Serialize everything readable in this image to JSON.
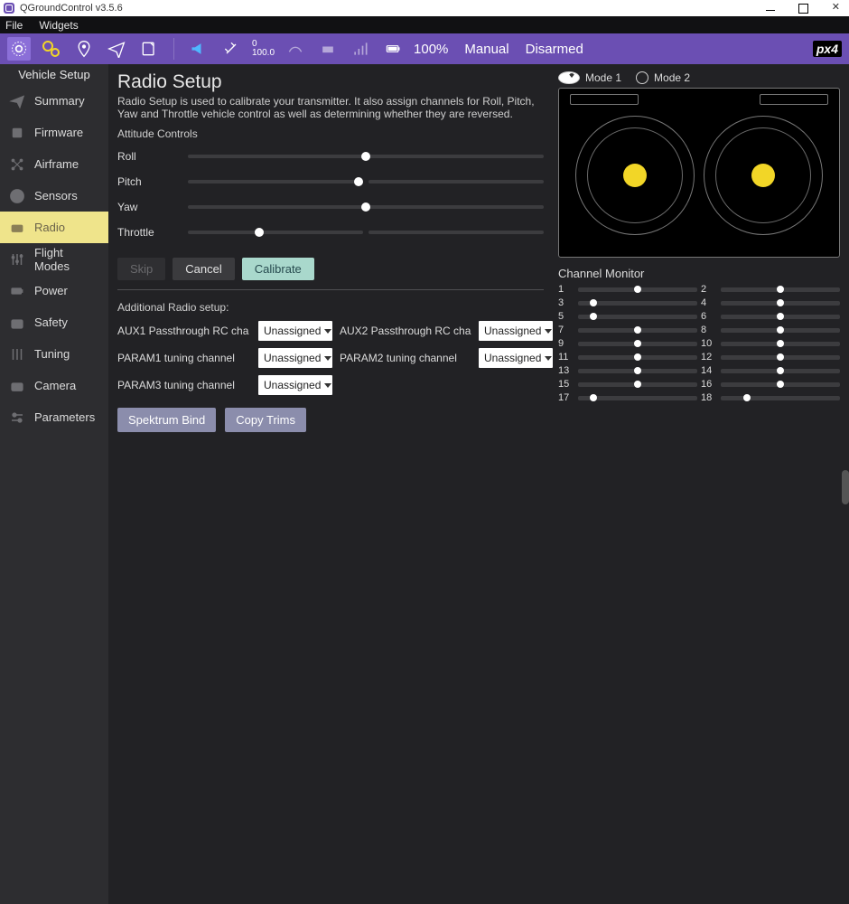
{
  "window": {
    "title": "QGroundControl v3.5.6"
  },
  "menu": {
    "file": "File",
    "widgets": "Widgets"
  },
  "toolbar": {
    "gps_top": "0",
    "gps_bottom": "100.0",
    "battery": "100%",
    "mode": "Manual",
    "arm": "Disarmed",
    "logo": "px4"
  },
  "sidebar": {
    "heading": "Vehicle Setup",
    "items": [
      {
        "label": "Summary"
      },
      {
        "label": "Firmware"
      },
      {
        "label": "Airframe"
      },
      {
        "label": "Sensors"
      },
      {
        "label": "Radio"
      },
      {
        "label": "Flight Modes"
      },
      {
        "label": "Power"
      },
      {
        "label": "Safety"
      },
      {
        "label": "Tuning"
      },
      {
        "label": "Camera"
      },
      {
        "label": "Parameters"
      }
    ]
  },
  "page": {
    "title": "Radio Setup",
    "desc": "Radio Setup is used to calibrate your transmitter. It also assign channels for Roll, Pitch, Yaw and Throttle vehicle control as well as determining whether they are reversed.",
    "attitude_heading": "Attitude Controls",
    "controls": [
      {
        "label": "Roll",
        "pos": 50
      },
      {
        "label": "Pitch",
        "pos": 48
      },
      {
        "label": "Yaw",
        "pos": 50
      },
      {
        "label": "Throttle",
        "pos": 20
      }
    ],
    "btn_skip": "Skip",
    "btn_cancel": "Cancel",
    "btn_calibrate": "Calibrate",
    "additional_heading": "Additional Radio setup:",
    "fields": {
      "aux1": "AUX1 Passthrough RC cha",
      "aux2": "AUX2 Passthrough RC cha",
      "param1": "PARAM1 tuning channel",
      "param2": "PARAM2 tuning channel",
      "param3": "PARAM3 tuning channel"
    },
    "unassigned": "Unassigned",
    "btn_spektrum": "Spektrum Bind",
    "btn_copytrims": "Copy Trims"
  },
  "modes": {
    "m1": "Mode 1",
    "m2": "Mode 2"
  },
  "channel_monitor": {
    "heading": "Channel Monitor",
    "channels": [
      {
        "n": 1,
        "p": 50
      },
      {
        "n": 2,
        "p": 50
      },
      {
        "n": 3,
        "p": 13
      },
      {
        "n": 4,
        "p": 50
      },
      {
        "n": 5,
        "p": 13
      },
      {
        "n": 6,
        "p": 50
      },
      {
        "n": 7,
        "p": 50
      },
      {
        "n": 8,
        "p": 50
      },
      {
        "n": 9,
        "p": 50
      },
      {
        "n": 10,
        "p": 50
      },
      {
        "n": 11,
        "p": 50
      },
      {
        "n": 12,
        "p": 50
      },
      {
        "n": 13,
        "p": 50
      },
      {
        "n": 14,
        "p": 50
      },
      {
        "n": 15,
        "p": 50
      },
      {
        "n": 16,
        "p": 50
      },
      {
        "n": 17,
        "p": 13
      },
      {
        "n": 18,
        "p": 22
      }
    ]
  }
}
